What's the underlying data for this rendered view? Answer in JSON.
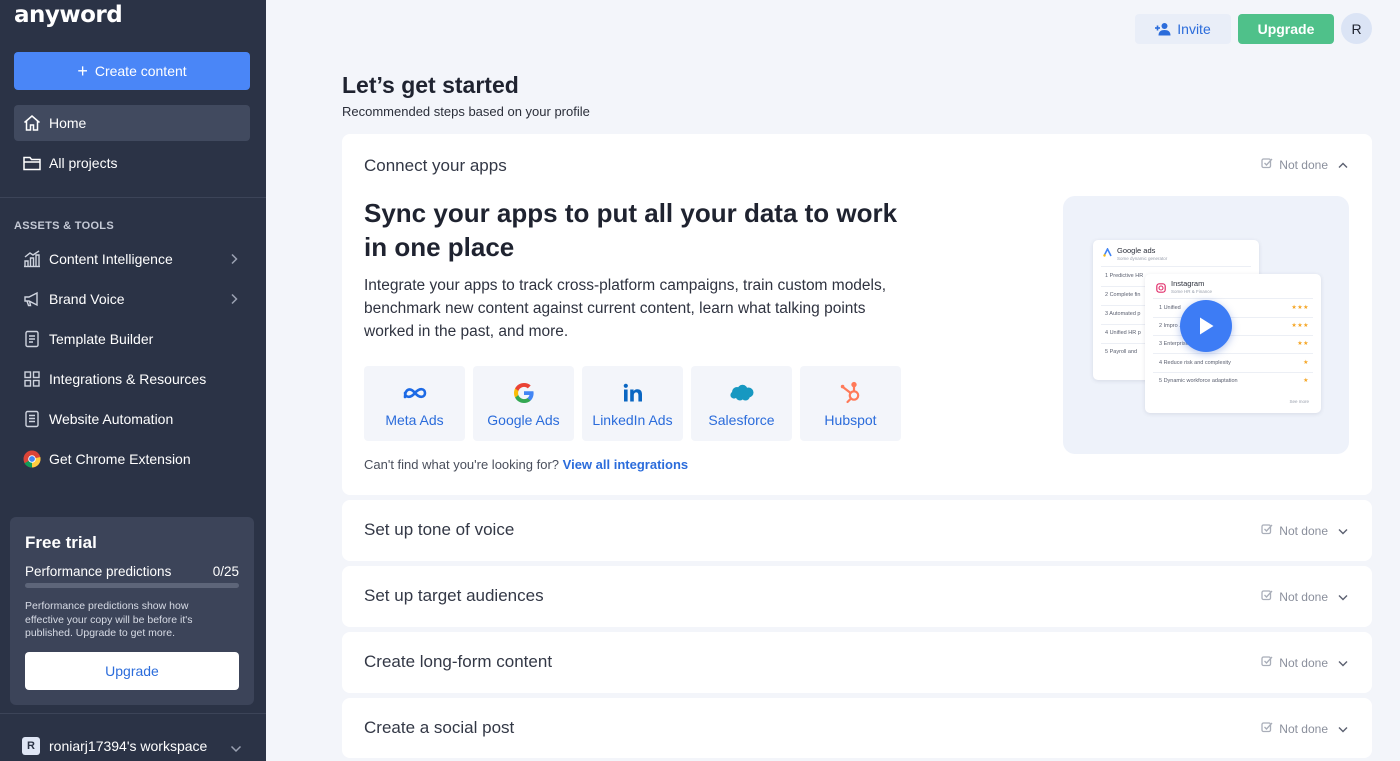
{
  "sidebar": {
    "logo": "anyword",
    "create_label": "Create content",
    "nav": [
      {
        "label": "Home"
      },
      {
        "label": "All projects"
      }
    ],
    "section_label": "ASSETS & TOOLS",
    "tools": [
      {
        "label": "Content Intelligence",
        "icon": "chart-icon"
      },
      {
        "label": "Brand Voice",
        "icon": "megaphone-icon"
      },
      {
        "label": "Template Builder",
        "icon": "document-icon"
      },
      {
        "label": "Integrations & Resources",
        "icon": "grid-icon"
      },
      {
        "label": "Website Automation",
        "icon": "page-icon"
      },
      {
        "label": "Get Chrome Extension",
        "icon": "chrome-icon"
      }
    ],
    "trial": {
      "title": "Free trial",
      "metric_label": "Performance predictions",
      "metric_value": "0/25",
      "progress": 0,
      "description": "Performance predictions show how effective your copy will be before it's published. Upgrade to get more.",
      "upgrade_label": "Upgrade"
    },
    "workspace": {
      "badge": "R",
      "name": "roniarj17394's workspace"
    }
  },
  "topbar": {
    "invite_label": "Invite",
    "upgrade_label": "Upgrade",
    "avatar_initial": "R"
  },
  "main": {
    "title": "Let’s get started",
    "subtitle": "Recommended steps based on your profile",
    "steps": [
      {
        "title": "Connect your apps",
        "status": "Not done",
        "expanded": true,
        "headline": "Sync your apps to put all your data to work in one place",
        "description": "Integrate your apps to track cross-platform campaigns, train custom models, benchmark new content against current content, learn what talking points worked in the past, and more.",
        "integrations": [
          {
            "label": "Meta Ads",
            "icon": "meta-icon"
          },
          {
            "label": "Google Ads",
            "icon": "google-icon"
          },
          {
            "label": "LinkedIn Ads",
            "icon": "linkedin-icon"
          },
          {
            "label": "Salesforce",
            "icon": "salesforce-icon"
          },
          {
            "label": "Hubspot",
            "icon": "hubspot-icon"
          }
        ],
        "cant_find_text": "Can't find what you're looking for?",
        "cant_find_link": "View all integrations",
        "preview": {
          "back_title": "Google ads",
          "back_sub": "Some dynamic generator",
          "back_rows": [
            "1 Predictive HR",
            "2 Complete fin",
            "3 Automated p",
            "4 Unified HR p",
            "5 Payroll and"
          ],
          "front_title": "Instagram",
          "front_sub": "Some HR & Finance",
          "front_rows": [
            {
              "text": "1 Unified",
              "stars": "★★★"
            },
            {
              "text": "2 Impro ... ts",
              "stars": "★★★"
            },
            {
              "text": "3 Enterprise ... cloud",
              "stars": "★★"
            },
            {
              "text": "4 Reduce risk and complexity",
              "stars": "★"
            },
            {
              "text": "5 Dynamic workforce adaptation",
              "stars": "★"
            }
          ],
          "see_more": "See more"
        }
      },
      {
        "title": "Set up tone of voice",
        "status": "Not done",
        "expanded": false
      },
      {
        "title": "Set up target audiences",
        "status": "Not done",
        "expanded": false
      },
      {
        "title": "Create long-form content",
        "status": "Not done",
        "expanded": false
      },
      {
        "title": "Create a social post",
        "status": "Not done",
        "expanded": false
      }
    ]
  },
  "colors": {
    "sidebar_bg": "#2b3346",
    "accent_blue": "#4a86f7",
    "link_blue": "#2b6cdb",
    "upgrade_green": "#4fc18a"
  }
}
